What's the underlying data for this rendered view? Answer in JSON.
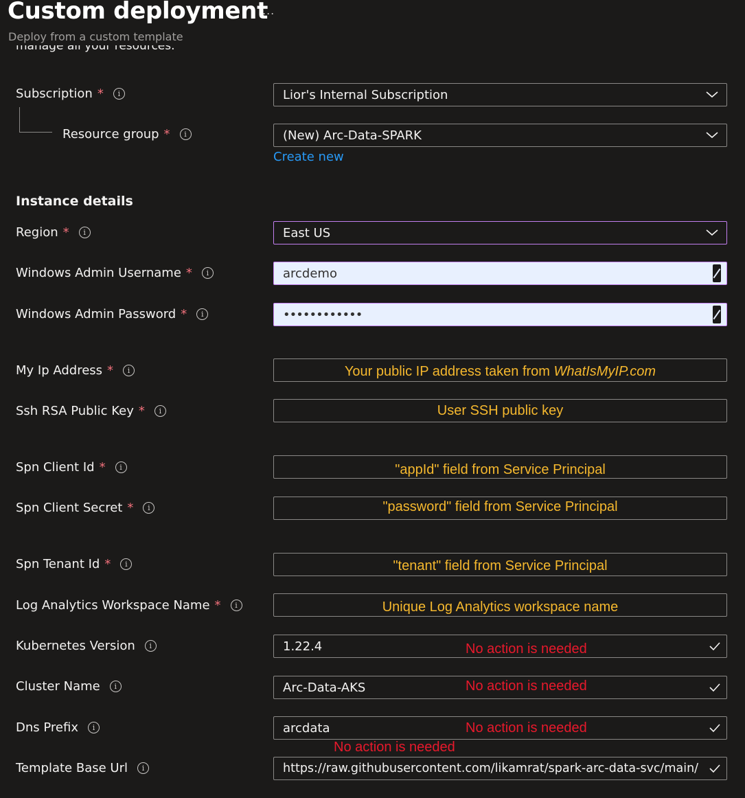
{
  "header": {
    "title": "Custom deployment",
    "more_label": "...",
    "subtitle": "Deploy from a custom template",
    "clipped_text": "manage all your resources."
  },
  "project": {
    "subscription": {
      "label": "Subscription",
      "value": "Lior's Internal Subscription"
    },
    "resource_group": {
      "label": "Resource group",
      "value": "(New) Arc-Data-SPARK",
      "create_new": "Create new"
    }
  },
  "instance": {
    "section_title": "Instance details",
    "region": {
      "label": "Region",
      "value": "East US"
    },
    "admin_username": {
      "label": "Windows Admin Username",
      "value": "arcdemo"
    },
    "admin_password": {
      "label": "Windows Admin Password",
      "value": "••••••••••••"
    },
    "my_ip": {
      "label": "My Ip Address",
      "hint": "Your public IP address taken from ",
      "hint_italic": "WhatIsMyIP.com"
    },
    "ssh_key": {
      "label": "Ssh RSA Public Key",
      "hint": "User SSH public key"
    },
    "spn_client_id": {
      "label": "Spn Client Id",
      "hint": "\"appId\" field from Service Principal"
    },
    "spn_client_secret": {
      "label": "Spn Client Secret",
      "hint": "\"password\" field from Service Principal"
    },
    "spn_tenant_id": {
      "label": "Spn Tenant Id",
      "hint": "\"tenant\" field from Service Principal"
    },
    "log_analytics": {
      "label": "Log Analytics Workspace Name",
      "hint": "Unique Log Analytics workspace name"
    },
    "k8s_version": {
      "label": "Kubernetes Version",
      "value": "1.22.4",
      "note": "No action is needed"
    },
    "cluster_name": {
      "label": "Cluster Name",
      "value": "Arc-Data-AKS",
      "note": "No action is needed"
    },
    "dns_prefix": {
      "label": "Dns Prefix",
      "value": "arcdata",
      "note": "No action is needed"
    },
    "template_url": {
      "label": "Template Base Url",
      "value": "https://raw.githubusercontent.com/likamrat/spark-arc-data-svc/main/",
      "note": "No action is needed"
    }
  },
  "required_mark": "*",
  "info_glyph": "i",
  "colors": {
    "background": "#1b1a19",
    "link": "#2899f5",
    "required": "#f1707b",
    "hint": "#f5b82e",
    "note": "#e8192c",
    "focus_border": "#c37ff0"
  }
}
